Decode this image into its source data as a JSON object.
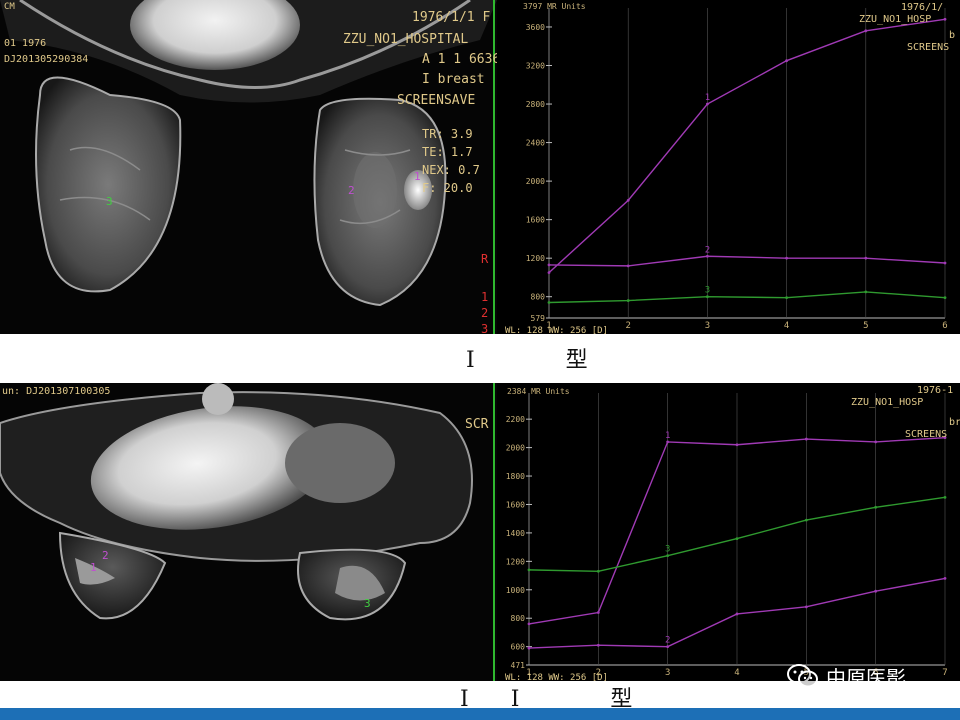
{
  "panel_top": {
    "overlay_left": [
      "01 1976",
      "DJ201305290384"
    ],
    "overlay_top_left": "CM",
    "overlay_right": [
      "1976/1/1 F",
      "ZZU_NO1_HOSPITAL",
      "A 1 1 6636",
      "I breast",
      "SCREENSAVE"
    ],
    "params": [
      "TR: 3.9",
      "TE: 1.7",
      "NEX: 0.7",
      "F: 20.0"
    ],
    "right_edge": [
      "R",
      "1",
      "2",
      "3"
    ],
    "roi_labels": [
      "1",
      "2",
      "3"
    ],
    "plot": {
      "units": "3797 MR Units",
      "header": [
        "1976/1/",
        "ZZU_NO1_HOSP",
        "b",
        "SCREENS"
      ],
      "bottom_text": "WL: 128 WW: 256 [D]",
      "y_ticks": [
        "3600",
        "3200",
        "2800",
        "2400",
        "2000",
        "1600",
        "1200",
        "800",
        "579"
      ],
      "x_ticks": [
        "1",
        "2",
        "3",
        "4",
        "5",
        "6"
      ]
    }
  },
  "panel_bottom": {
    "overlay_left": [
      "un: DJ201307100305"
    ],
    "overlay_right": [
      "SCR"
    ],
    "roi_labels": [
      "1",
      "2",
      "3"
    ],
    "plot": {
      "units": "2384 MR Units",
      "header": [
        "1976-1",
        "ZZU_NO1_HOSP",
        "br",
        "SCREENS"
      ],
      "bottom_text": "WL: 128 WW: 256 [D]",
      "y_ticks": [
        "2200",
        "2000",
        "1800",
        "1600",
        "1400",
        "1200",
        "1000",
        "800",
        "600",
        "471"
      ],
      "x_ticks": [
        "1",
        "2",
        "3",
        "4",
        "5",
        "6",
        "7"
      ]
    }
  },
  "labels": {
    "type1": "I 型",
    "type2": "II 型"
  },
  "watermark": {
    "text": "中原医影",
    "icon": "wechat-icon"
  },
  "chart_data": [
    {
      "type": "line",
      "x": [
        1,
        2,
        3,
        4,
        5,
        6
      ],
      "ylim": [
        579,
        3797
      ],
      "series": [
        {
          "name": "1",
          "color": "#a03ab5",
          "values": [
            1050,
            1800,
            2800,
            3250,
            3560,
            3680
          ]
        },
        {
          "name": "2",
          "color": "#a03ab5",
          "values": [
            1130,
            1120,
            1220,
            1200,
            1200,
            1150
          ]
        },
        {
          "name": "3",
          "color": "#2f9a2f",
          "values": [
            740,
            760,
            800,
            790,
            850,
            790
          ]
        }
      ]
    },
    {
      "type": "line",
      "x": [
        1,
        2,
        3,
        4,
        5,
        6,
        7
      ],
      "ylim": [
        471,
        2384
      ],
      "series": [
        {
          "name": "1",
          "color": "#a03ab5",
          "values": [
            760,
            840,
            2040,
            2020,
            2060,
            2040,
            2070
          ]
        },
        {
          "name": "2",
          "color": "#a03ab5",
          "values": [
            590,
            610,
            600,
            830,
            880,
            990,
            1080
          ]
        },
        {
          "name": "3",
          "color": "#2f9a2f",
          "values": [
            1140,
            1130,
            1240,
            1360,
            1490,
            1580,
            1650
          ]
        }
      ]
    }
  ]
}
